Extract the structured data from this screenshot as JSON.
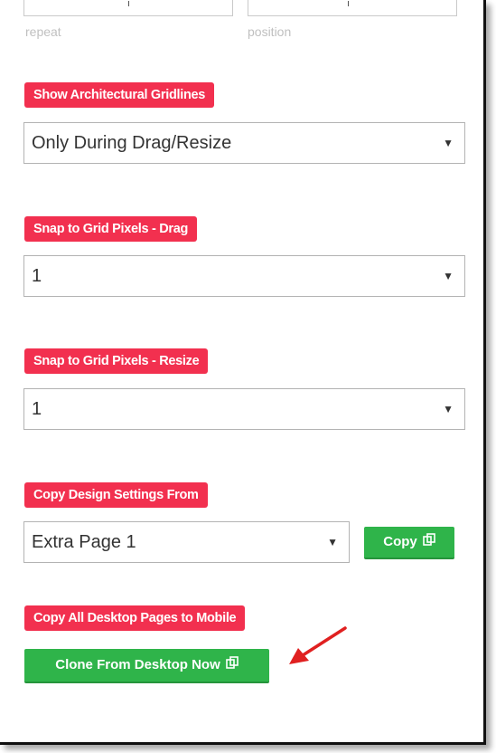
{
  "top": {
    "repeat_hint": "repeat",
    "position_hint": "position"
  },
  "settings": {
    "gridlines": {
      "label": "Show Architectural Gridlines",
      "value": "Only During Drag/Resize"
    },
    "snap_drag": {
      "label": "Snap to Grid Pixels - Drag",
      "value": "1"
    },
    "snap_resize": {
      "label": "Snap to Grid Pixels - Resize",
      "value": "1"
    },
    "copy_design": {
      "label": "Copy Design Settings From",
      "value": "Extra Page 1",
      "button": "Copy"
    },
    "copy_mobile": {
      "label": "Copy All Desktop Pages to Mobile",
      "button": "Clone From Desktop Now"
    }
  },
  "icons": {
    "select_arrow": "dropdown-caret-icon",
    "copy": "copy-icon",
    "annotation": "red-arrow-icon"
  },
  "colors": {
    "badge": "#f2304f",
    "button": "#2fb44a",
    "annotation_arrow": "#e02020"
  }
}
